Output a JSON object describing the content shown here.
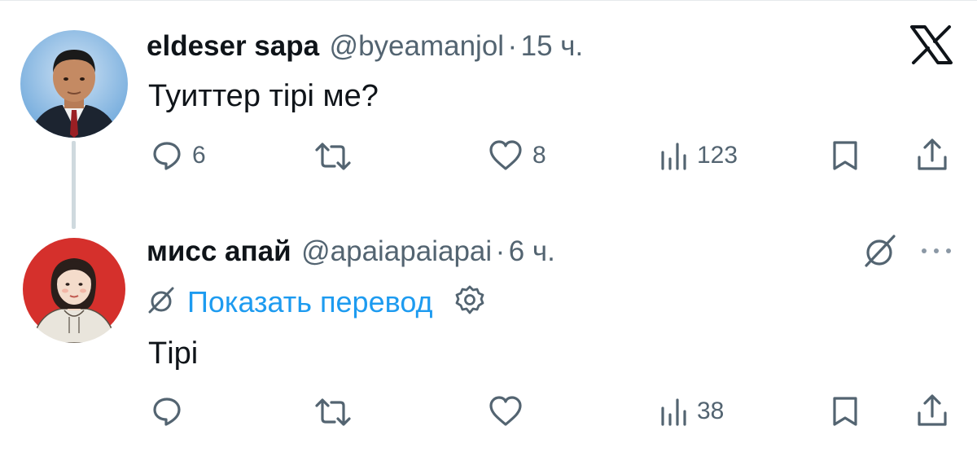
{
  "tweet": {
    "author_name": "eldeser sapa",
    "handle": "@byeamanjol",
    "separator": "·",
    "time": "15 ч.",
    "text": "Туиттер тірі ме?",
    "actions": {
      "replies": "6",
      "reposts": "",
      "likes": "8",
      "views": "123"
    }
  },
  "reply": {
    "author_name": "мисс апай",
    "handle": "@apaiapaiapai",
    "separator": "·",
    "time": "6 ч.",
    "translate_label": "Показать перевод",
    "text": "Тірі",
    "actions": {
      "replies": "",
      "reposts": "",
      "likes": "",
      "views": "38"
    }
  },
  "icons": {
    "logo": "x-logo-icon",
    "reply": "reply-icon",
    "repost": "repost-icon",
    "like": "like-icon",
    "views": "views-icon",
    "bookmark": "bookmark-icon",
    "share": "share-icon",
    "translate": "translate-icon",
    "settings": "gear-icon",
    "more": "more-icon"
  },
  "colors": {
    "text": "#0f1419",
    "secondary": "#536471",
    "accent": "#1d9bf0",
    "thread_line": "#cfd9de"
  }
}
